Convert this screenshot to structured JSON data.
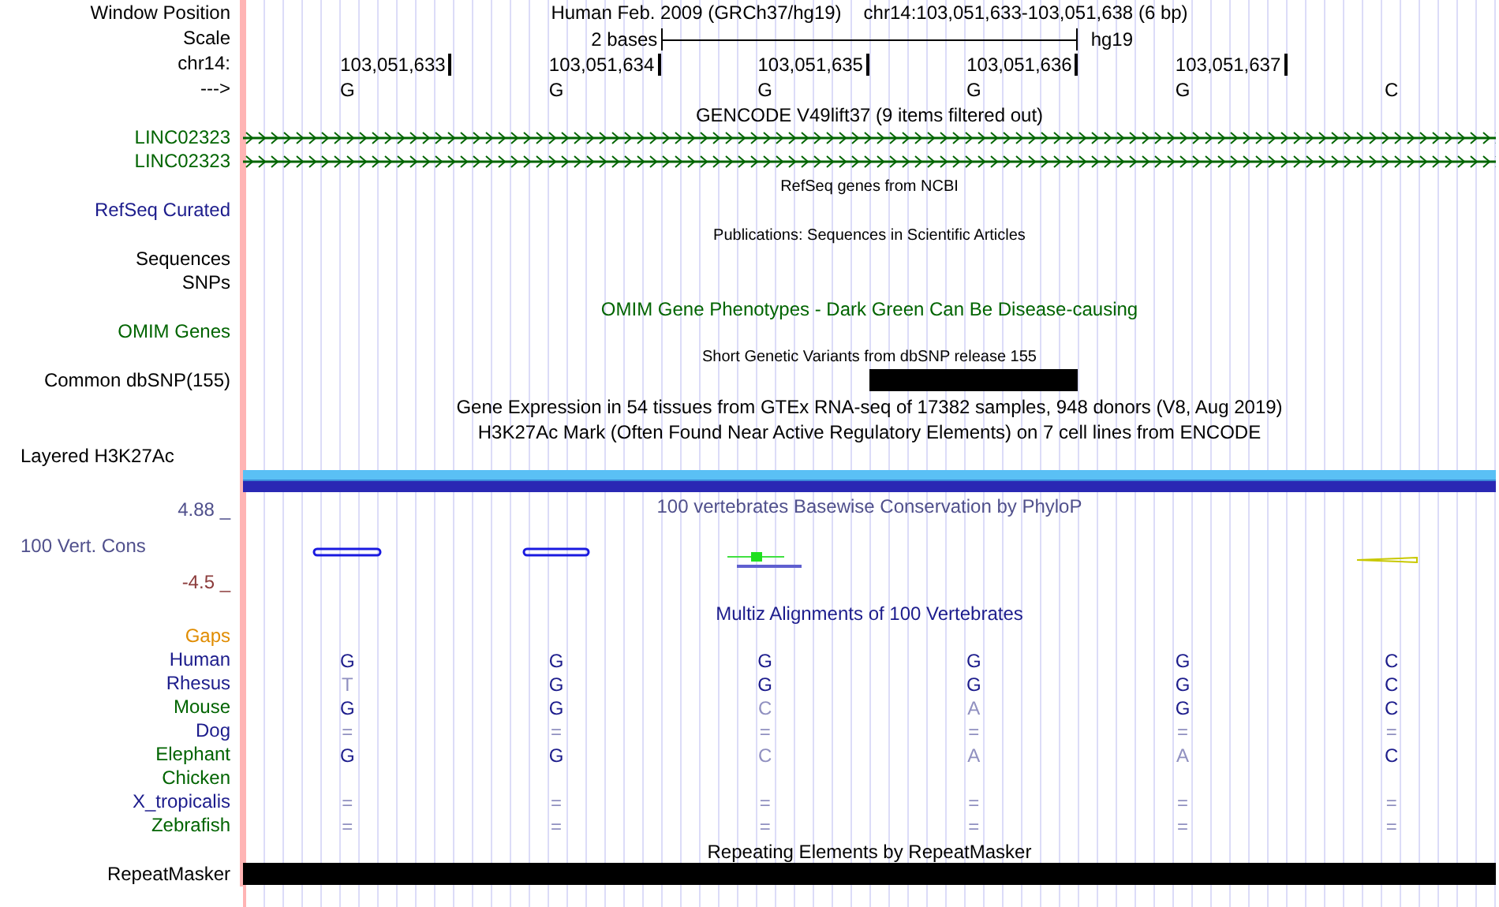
{
  "header": {
    "label": "Window Position",
    "assembly": "Human Feb. 2009 (GRCh37/hg19)",
    "position": "chr14:103,051,633-103,051,638 (6 bp)"
  },
  "scale": {
    "label": "Scale",
    "length": "2 bases",
    "assembly": "hg19"
  },
  "ruler": {
    "label": "chr14:",
    "ticks": [
      "103,051,633",
      "103,051,634",
      "103,051,635",
      "103,051,636",
      "103,051,637"
    ]
  },
  "sequence": {
    "label": "--->",
    "bases": [
      "G",
      "G",
      "G",
      "G",
      "G",
      "C"
    ]
  },
  "tracks": [
    {
      "kind": "title",
      "text": "GENCODE V49lift37 (9 items filtered out)",
      "color": "#000000"
    },
    {
      "kind": "gene",
      "label": "LINC02323",
      "color": "#006400"
    },
    {
      "kind": "gene",
      "label": "LINC02323",
      "color": "#006400"
    },
    {
      "kind": "subtitle",
      "text": "RefSeq genes from NCBI",
      "color": "#000000"
    },
    {
      "kind": "label",
      "label": "RefSeq Curated",
      "color": "#1c1c8c"
    },
    {
      "kind": "subtitle",
      "text": "Publications: Sequences in Scientific Articles",
      "color": "#000000"
    },
    {
      "kind": "label",
      "label": "Sequences",
      "color": "#000000"
    },
    {
      "kind": "label",
      "label": "SNPs",
      "color": "#000000"
    },
    {
      "kind": "title",
      "text": "OMIM Gene Phenotypes - Dark Green Can Be Disease-causing",
      "color": "#006400"
    },
    {
      "kind": "label",
      "label": "OMIM Genes",
      "color": "#006400"
    },
    {
      "kind": "subtitle",
      "text": "Short Genetic Variants from dbSNP release 155",
      "color": "#000000"
    },
    {
      "kind": "variant",
      "label": "Common dbSNP(155)",
      "color": "#000000"
    },
    {
      "kind": "title",
      "text": "Gene Expression in 54 tissues from GTEx RNA-seq of 17382 samples, 948 donors (V8, Aug 2019)",
      "color": "#000000"
    },
    {
      "kind": "title",
      "text": "H3K27Ac Mark (Often Found Near Active Regulatory Elements) on 7 cell lines from ENCODE",
      "color": "#000000"
    },
    {
      "kind": "layered",
      "label": "Layered H3K27Ac",
      "color": "#000000"
    },
    {
      "kind": "wiggle",
      "label": "100 Vert. Cons",
      "color": "#50508c",
      "max": "4.88 _",
      "min": "-4.5 _",
      "title": "100 vertebrates Basewise Conservation by PhyloP"
    },
    {
      "kind": "title",
      "text": "Multiz Alignments of 100 Vertebrates",
      "color": "#1c1c8c"
    },
    {
      "kind": "label",
      "label": "Gaps",
      "color": "#e08c00"
    },
    {
      "kind": "alignment",
      "label": "Human",
      "color": "#1c1c8c",
      "bases": [
        {
          "text": "G",
          "faded": false
        },
        {
          "text": "G",
          "faded": false
        },
        {
          "text": "G",
          "faded": false
        },
        {
          "text": "G",
          "faded": false
        },
        {
          "text": "G",
          "faded": false
        },
        {
          "text": "C",
          "faded": false
        }
      ]
    },
    {
      "kind": "alignment",
      "label": "Rhesus",
      "color": "#1c1c8c",
      "bases": [
        {
          "text": "T",
          "faded": true
        },
        {
          "text": "G",
          "faded": false
        },
        {
          "text": "G",
          "faded": false
        },
        {
          "text": "G",
          "faded": false
        },
        {
          "text": "G",
          "faded": false
        },
        {
          "text": "C",
          "faded": false
        }
      ]
    },
    {
      "kind": "alignment",
      "label": "Mouse",
      "color": "#006400",
      "bases": [
        {
          "text": "G",
          "faded": false
        },
        {
          "text": "G",
          "faded": false
        },
        {
          "text": "C",
          "faded": true
        },
        {
          "text": "A",
          "faded": true
        },
        {
          "text": "G",
          "faded": false
        },
        {
          "text": "C",
          "faded": false
        }
      ]
    },
    {
      "kind": "alignment",
      "label": "Dog",
      "color": "#1c1c8c",
      "bases": [
        {
          "text": "=",
          "faded": true
        },
        {
          "text": "=",
          "faded": true
        },
        {
          "text": "=",
          "faded": true
        },
        {
          "text": "=",
          "faded": true
        },
        {
          "text": "=",
          "faded": true
        },
        {
          "text": "=",
          "faded": true
        }
      ]
    },
    {
      "kind": "alignment",
      "label": "Elephant",
      "color": "#006400",
      "bases": [
        {
          "text": "G",
          "faded": false
        },
        {
          "text": "G",
          "faded": false
        },
        {
          "text": "C",
          "faded": true
        },
        {
          "text": "A",
          "faded": true
        },
        {
          "text": "A",
          "faded": true
        },
        {
          "text": "C",
          "faded": false
        }
      ]
    },
    {
      "kind": "label",
      "label": "Chicken",
      "color": "#006400"
    },
    {
      "kind": "alignment",
      "label": "X_tropicalis",
      "color": "#1c1c8c",
      "bases": [
        {
          "text": "=",
          "faded": true
        },
        {
          "text": "=",
          "faded": true
        },
        {
          "text": "=",
          "faded": true
        },
        {
          "text": "=",
          "faded": true
        },
        {
          "text": "=",
          "faded": true
        },
        {
          "text": "=",
          "faded": true
        }
      ]
    },
    {
      "kind": "alignment",
      "label": "Zebrafish",
      "color": "#006400",
      "bases": [
        {
          "text": "=",
          "faded": true
        },
        {
          "text": "=",
          "faded": true
        },
        {
          "text": "=",
          "faded": true
        },
        {
          "text": "=",
          "faded": true
        },
        {
          "text": "=",
          "faded": true
        },
        {
          "text": "=",
          "faded": true
        }
      ]
    },
    {
      "kind": "title",
      "text": "Repeating Elements by RepeatMasker",
      "color": "#000000"
    },
    {
      "kind": "repeat",
      "label": "RepeatMasker",
      "color": "#000000"
    }
  ]
}
